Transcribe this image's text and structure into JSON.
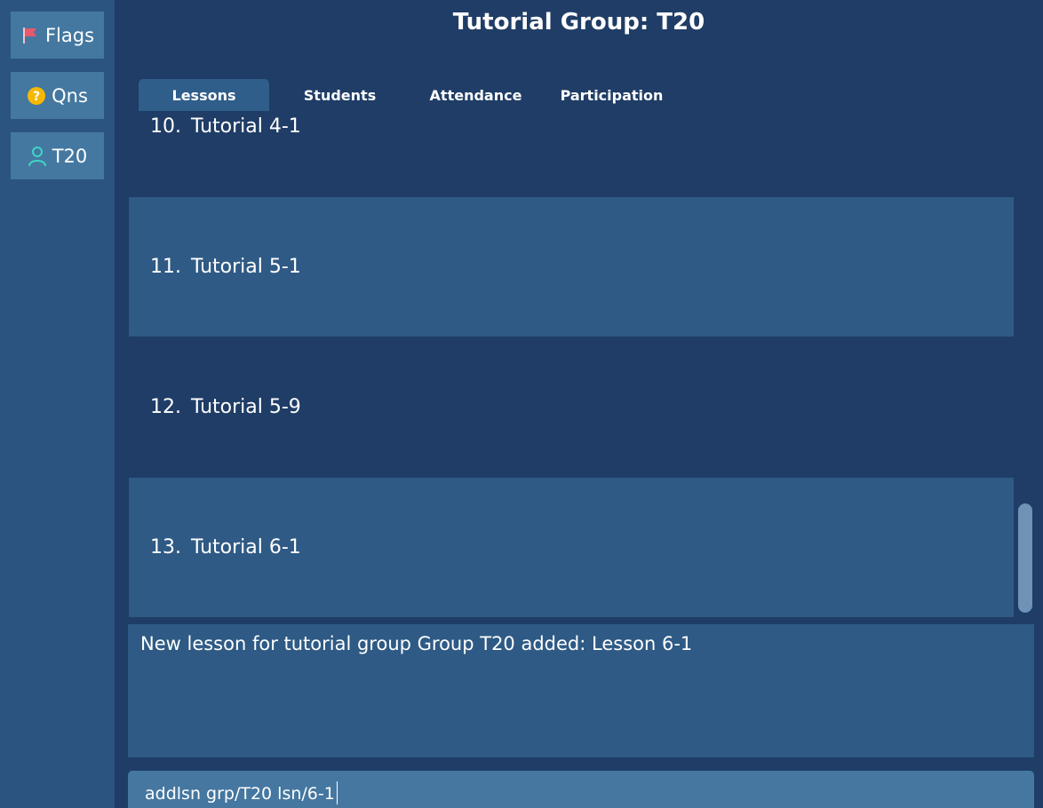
{
  "sidebar": {
    "items": [
      {
        "label": "Flags",
        "icon": "flag-icon"
      },
      {
        "label": "Qns",
        "icon": "question-icon"
      },
      {
        "label": "T20",
        "icon": "person-icon"
      }
    ]
  },
  "header": {
    "title": "Tutorial Group: T20"
  },
  "tabs": [
    {
      "label": "Lessons",
      "active": true
    },
    {
      "label": "Students",
      "active": false
    },
    {
      "label": "Attendance",
      "active": false
    },
    {
      "label": "Participation",
      "active": false
    }
  ],
  "lessons": [
    {
      "number": "10.",
      "name": "Tutorial 4-1"
    },
    {
      "number": "11.",
      "name": "Tutorial 5-1"
    },
    {
      "number": "12.",
      "name": "Tutorial 5-9"
    },
    {
      "number": "13.",
      "name": "Tutorial 6-1"
    }
  ],
  "result": {
    "message": "New lesson for tutorial group Group T20 added: Lesson 6-1"
  },
  "command": {
    "value": "addlsn grp/T20 lsn/6-1"
  },
  "colors": {
    "background": "#1f3d66",
    "sidebar": "#2b5580",
    "button": "#4478a0",
    "row_alt": "#2f5a85",
    "flag": "#e8586e",
    "question": "#f5b800",
    "person": "#3dd6c4"
  }
}
